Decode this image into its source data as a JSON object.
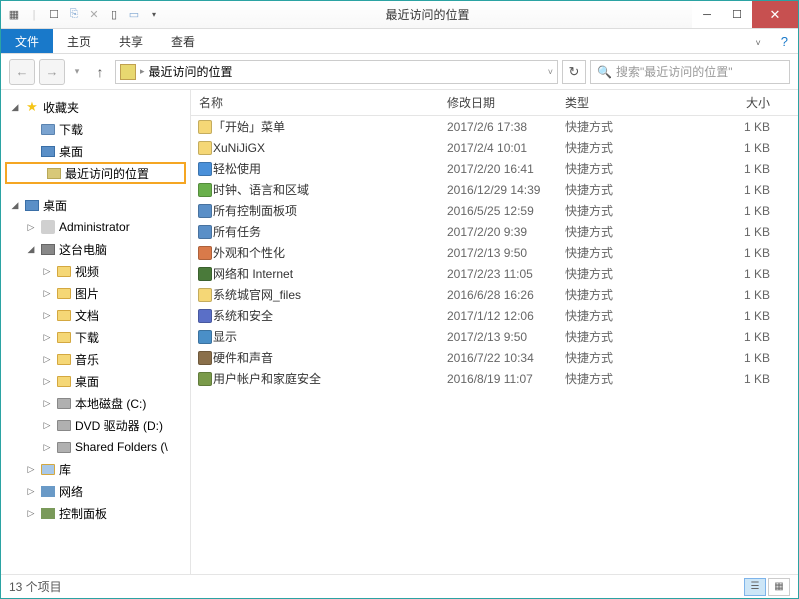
{
  "titlebar": {
    "title": "最近访问的位置"
  },
  "ribbon": {
    "file": "文件",
    "tabs": [
      "主页",
      "共享",
      "查看"
    ]
  },
  "address": {
    "path": "最近访问的位置"
  },
  "search": {
    "placeholder": "搜索\"最近访问的位置\""
  },
  "columns": {
    "name": "名称",
    "date": "修改日期",
    "type": "类型",
    "size": "大小"
  },
  "sidebar": {
    "favorites": {
      "label": "收藏夹",
      "items": [
        "下载",
        "桌面",
        "最近访问的位置"
      ]
    },
    "desktop": {
      "label": "桌面",
      "admin": "Administrator",
      "computer": {
        "label": "这台电脑",
        "items": [
          "视频",
          "图片",
          "文档",
          "下载",
          "音乐",
          "桌面",
          "本地磁盘 (C:)",
          "DVD 驱动器 (D:)",
          "Shared Folders (\\"
        ]
      },
      "libraries": "库",
      "network": "网络",
      "control": "控制面板"
    }
  },
  "files": [
    {
      "name": "「开始」菜单",
      "date": "2017/2/6 17:38",
      "type": "快捷方式",
      "size": "1 KB",
      "icon": "folder"
    },
    {
      "name": "XuNiJiGX",
      "date": "2017/2/4 10:01",
      "type": "快捷方式",
      "size": "1 KB",
      "icon": "folder"
    },
    {
      "name": "轻松使用",
      "date": "2017/2/20 16:41",
      "type": "快捷方式",
      "size": "1 KB",
      "icon": "globe"
    },
    {
      "name": "时钟、语言和区域",
      "date": "2016/12/29 14:39",
      "type": "快捷方式",
      "size": "1 KB",
      "icon": "clock"
    },
    {
      "name": "所有控制面板项",
      "date": "2016/5/25 12:59",
      "type": "快捷方式",
      "size": "1 KB",
      "icon": "panel"
    },
    {
      "name": "所有任务",
      "date": "2017/2/20 9:39",
      "type": "快捷方式",
      "size": "1 KB",
      "icon": "panel"
    },
    {
      "name": "外观和个性化",
      "date": "2017/2/13 9:50",
      "type": "快捷方式",
      "size": "1 KB",
      "icon": "appearance"
    },
    {
      "name": "网络和 Internet",
      "date": "2017/2/23 11:05",
      "type": "快捷方式",
      "size": "1 KB",
      "icon": "network"
    },
    {
      "name": "系统城官网_files",
      "date": "2016/6/28 16:26",
      "type": "快捷方式",
      "size": "1 KB",
      "icon": "folder"
    },
    {
      "name": "系统和安全",
      "date": "2017/1/12 12:06",
      "type": "快捷方式",
      "size": "1 KB",
      "icon": "system"
    },
    {
      "name": "显示",
      "date": "2017/2/13 9:50",
      "type": "快捷方式",
      "size": "1 KB",
      "icon": "display"
    },
    {
      "name": "硬件和声音",
      "date": "2016/7/22 10:34",
      "type": "快捷方式",
      "size": "1 KB",
      "icon": "hardware"
    },
    {
      "name": "用户帐户和家庭安全",
      "date": "2016/8/19 11:07",
      "type": "快捷方式",
      "size": "1 KB",
      "icon": "users"
    }
  ],
  "status": {
    "count": "13 个项目"
  },
  "icons": {
    "folder": "#f5d776",
    "globe": "#4a90d9",
    "clock": "#6ab04c",
    "panel": "#5a8fc7",
    "appearance": "#d97a4a",
    "network": "#4a7a3a",
    "system": "#5a6fc7",
    "display": "#4a8fc7",
    "hardware": "#8a6f4a",
    "users": "#7a9a4a"
  }
}
